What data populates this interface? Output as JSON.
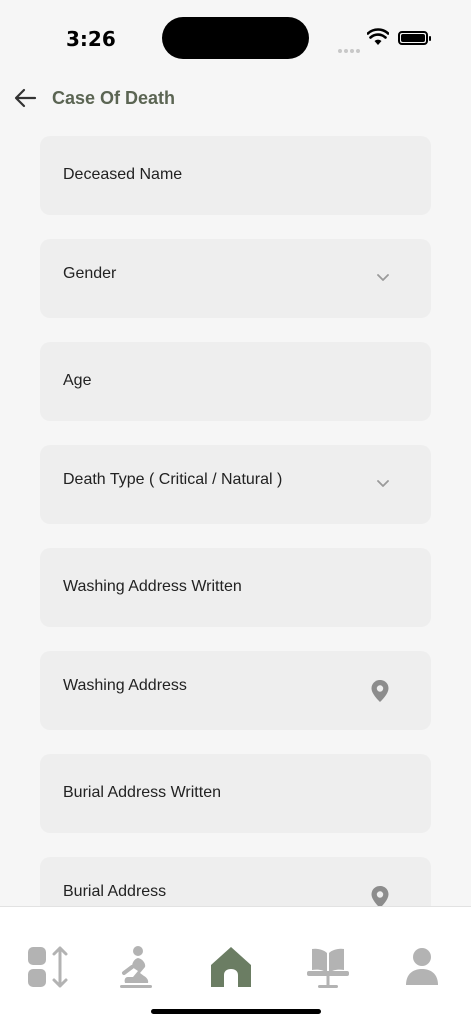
{
  "status_bar": {
    "time": "3:26"
  },
  "header": {
    "title": "Case Of Death"
  },
  "form": {
    "fields": [
      {
        "label": "Deceased Name",
        "type": "text"
      },
      {
        "label": "Gender",
        "type": "select"
      },
      {
        "label": "Age",
        "type": "text"
      },
      {
        "label": "Death Type ( Critical / Natural )",
        "type": "select"
      },
      {
        "label": "Washing Address Written",
        "type": "text"
      },
      {
        "label": "Washing Address",
        "type": "location"
      },
      {
        "label": "Burial Address Written",
        "type": "text"
      },
      {
        "label": "Burial Address",
        "type": "location"
      }
    ]
  },
  "bottom_nav": {
    "items": [
      "reorder-icon",
      "prayer-icon",
      "home-icon",
      "quran-stand-icon",
      "profile-icon"
    ],
    "active": "home-icon",
    "active_color": "#6b7d63",
    "inactive_color": "#b3b3b3"
  },
  "colors": {
    "accent": "#5b6553",
    "field_bg": "#eeeeee",
    "page_bg": "#f6f6f6"
  }
}
